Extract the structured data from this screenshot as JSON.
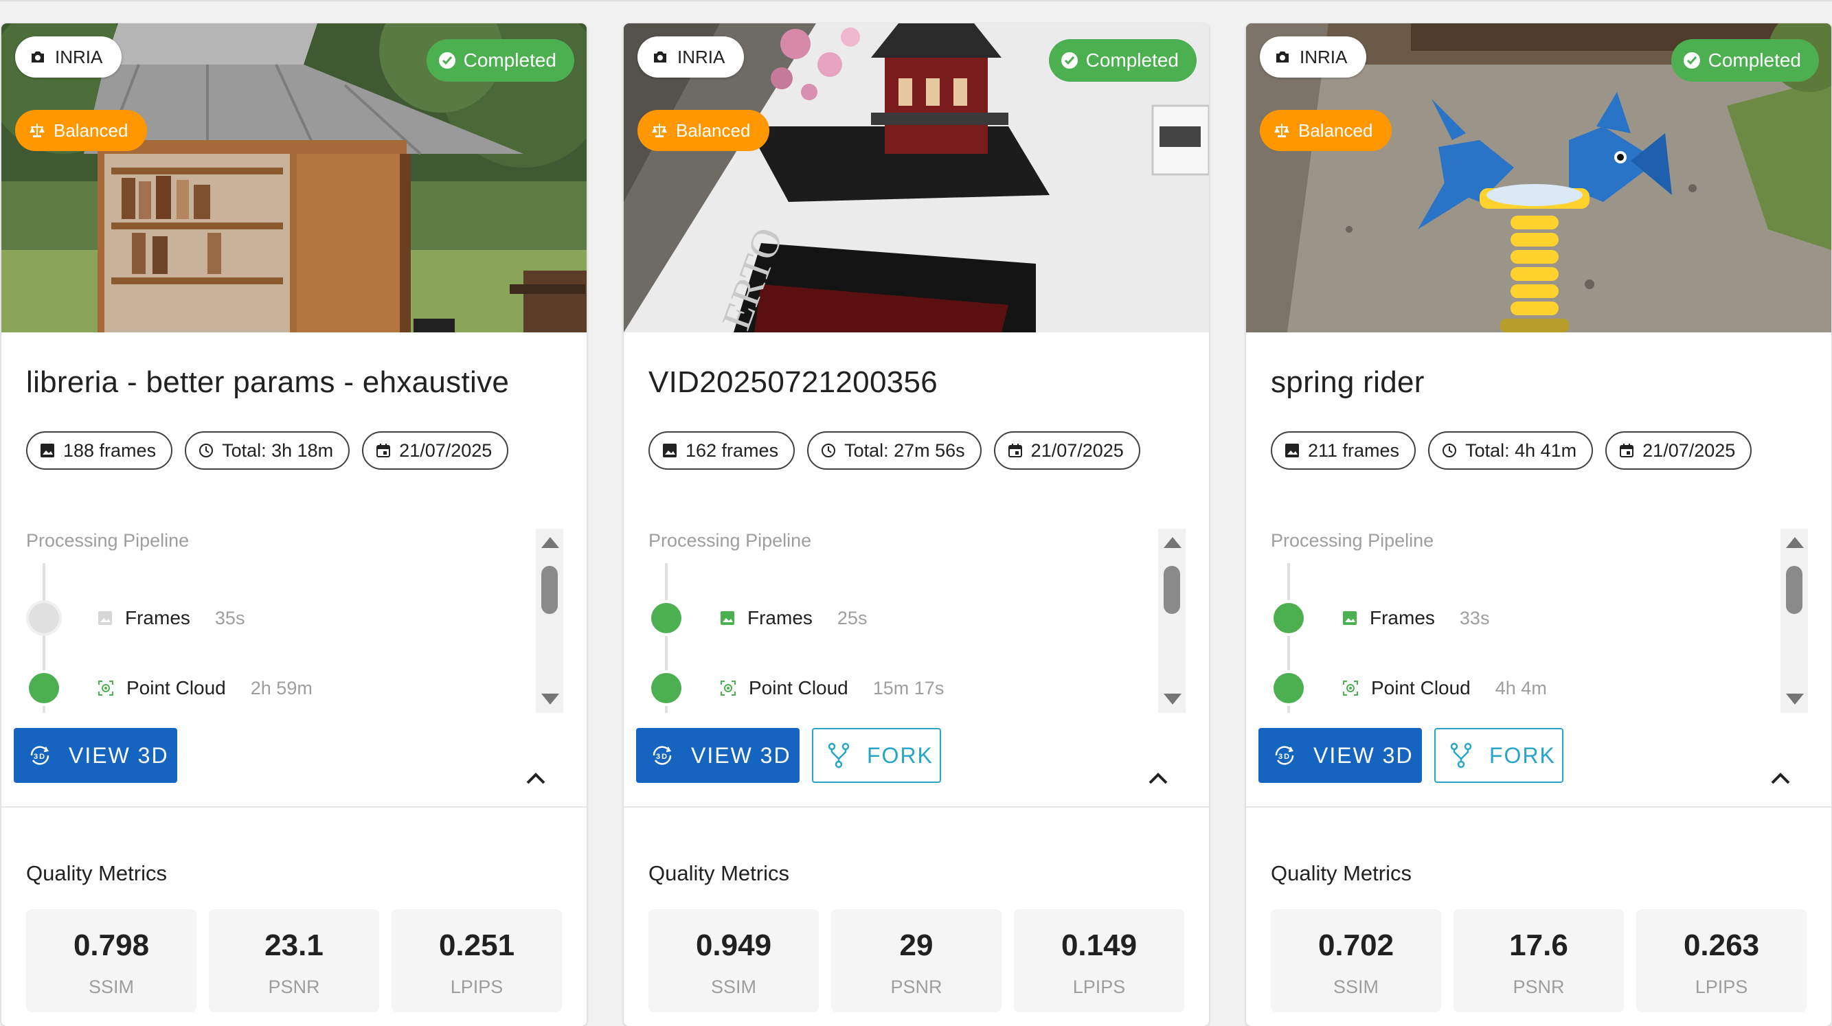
{
  "colors": {
    "accent_blue": "#1565c0",
    "fork_teal": "#26a5c9",
    "completed_green": "#4caf50",
    "balanced_orange": "#ff9800",
    "pending_gray": "#e0e0e0"
  },
  "labels": {
    "pipeline_title": "Processing Pipeline",
    "view_3d": "VIEW 3D",
    "fork": "FORK",
    "quality_metrics": "Quality Metrics",
    "ssim": "SSIM",
    "psnr": "PSNR",
    "lpips": "LPIPS"
  },
  "cards": [
    {
      "source": "INRIA",
      "mode": "Balanced",
      "status": "Completed",
      "title": "libreria - better params - ehxaustive",
      "frames": "188 frames",
      "total": "Total: 3h 18m",
      "date": "21/07/2025",
      "steps": [
        {
          "name": "Frames",
          "time": "35s",
          "state": "pending"
        },
        {
          "name": "Point Cloud",
          "time": "2h 59m",
          "state": "done"
        }
      ],
      "has_fork": false,
      "metrics": {
        "ssim": "0.798",
        "psnr": "23.1",
        "lpips": "0.251"
      }
    },
    {
      "source": "INRIA",
      "mode": "Balanced",
      "status": "Completed",
      "title": "VID20250721200356",
      "frames": "162 frames",
      "total": "Total: 27m 56s",
      "date": "21/07/2025",
      "steps": [
        {
          "name": "Frames",
          "time": "25s",
          "state": "done"
        },
        {
          "name": "Point Cloud",
          "time": "15m 17s",
          "state": "done"
        }
      ],
      "has_fork": true,
      "metrics": {
        "ssim": "0.949",
        "psnr": "29",
        "lpips": "0.149"
      }
    },
    {
      "source": "INRIA",
      "mode": "Balanced",
      "status": "Completed",
      "title": "spring rider",
      "frames": "211 frames",
      "total": "Total: 4h 41m",
      "date": "21/07/2025",
      "steps": [
        {
          "name": "Frames",
          "time": "33s",
          "state": "done"
        },
        {
          "name": "Point Cloud",
          "time": "4h 4m",
          "state": "done"
        }
      ],
      "has_fork": true,
      "metrics": {
        "ssim": "0.702",
        "psnr": "17.6",
        "lpips": "0.263"
      }
    }
  ]
}
